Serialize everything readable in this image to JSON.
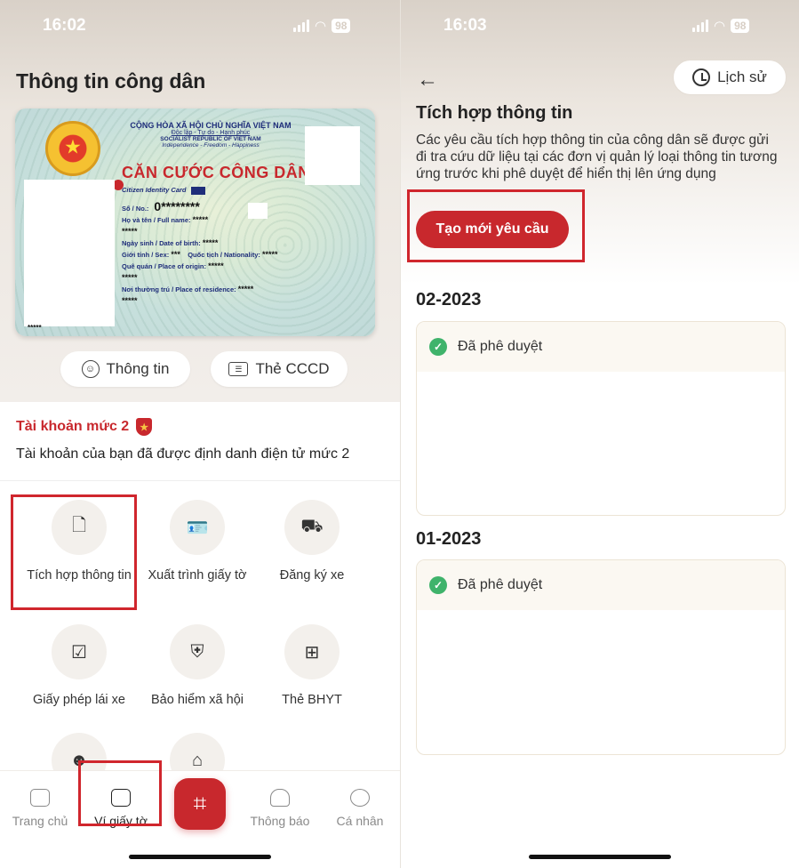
{
  "left": {
    "time": "16:02",
    "battery": "98",
    "title": "Thông tin công dân",
    "card": {
      "line1": "CỘNG HÒA XÃ HỘI CHỦ NGHĨA VIỆT NAM",
      "line2": "Độc lập - Tự do - Hạnh phúc",
      "line3": "SOCIALIST REPUBLIC OF VIET NAM",
      "line4": "Independence - Freedom - Happiness",
      "big": "CĂN CƯỚC CÔNG DÂN",
      "sub": "Citizen Identity Card",
      "no_label": "Số / No.:",
      "no_value": "0********",
      "name_label": "Họ và tên / Full name:",
      "name_value": "*****",
      "name_value2": "*****",
      "dob_label": "Ngày sinh / Date of birth:",
      "dob_value": "*****",
      "sex_label": "Giới tính / Sex:",
      "sex_value": "***",
      "nat_label": "Quốc tịch / Nationality:",
      "nat_value": "*****",
      "origin_label": "Quê quán / Place of origin:",
      "origin_value": "*****",
      "origin_value2": "*****",
      "res_label": "Nơi thường trú / Place of residence:",
      "res_value": "*****",
      "res_value2": "*****",
      "corner": "*****"
    },
    "btn_info": "Thông tin",
    "btn_card": "Thẻ CCCD",
    "account_title": "Tài khoản mức 2",
    "account_desc": "Tài khoản của bạn đã được định danh điện tử mức 2",
    "tiles": [
      {
        "label": "Tích hợp thông tin",
        "icon": "document-add-icon"
      },
      {
        "label": "Xuất trình giấy tờ",
        "icon": "id-card-hand-icon"
      },
      {
        "label": "Đăng ký xe",
        "icon": "car-icon"
      },
      {
        "label": "Giấy phép lái xe",
        "icon": "license-icon"
      },
      {
        "label": "Bảo hiểm xã hội",
        "icon": "shield-plus-icon"
      },
      {
        "label": "Thẻ BHYT",
        "icon": "health-card-icon"
      }
    ],
    "tabs": {
      "home": "Trang chủ",
      "wallet": "Ví giấy tờ",
      "notify": "Thông báo",
      "profile": "Cá nhân"
    },
    "colors": {
      "accent": "#c8282d",
      "highlight": "#d0262d"
    }
  },
  "right": {
    "time": "16:03",
    "battery": "98",
    "history": "Lịch sử",
    "title": "Tích hợp thông tin",
    "desc": "Các yêu cầu tích hợp thông tin của công dân sẽ được gửi đi tra cứu dữ liệu tại các đơn vị quản lý loại thông tin tương ứng trước khi phê duyệt để hiển thị lên ứng dụng",
    "new_request": "Tạo mới yêu cầu",
    "groups": [
      {
        "month": "02-2023",
        "status": "Đã phê duyệt"
      },
      {
        "month": "01-2023",
        "status": "Đã phê duyệt"
      }
    ],
    "colors": {
      "approved": "#3fb36b"
    }
  }
}
